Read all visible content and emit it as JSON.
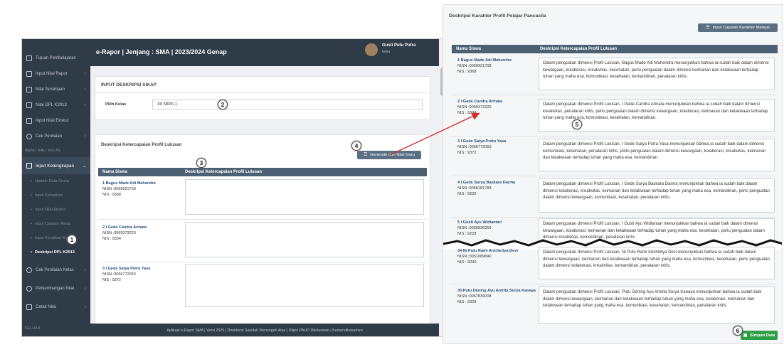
{
  "left": {
    "sidebar": {
      "items": [
        {
          "label": "Tujuan Pembelajaran",
          "icon": "book-icon",
          "chevron": ""
        },
        {
          "label": "Input Nilai Rapor",
          "icon": "table-icon",
          "chevron": "‹"
        },
        {
          "label": "Nilai Tersimpan",
          "icon": "table-icon",
          "chevron": "‹"
        },
        {
          "label": "Nilai DPL K2013",
          "icon": "table-icon",
          "chevron": "‹"
        },
        {
          "label": "Input Nilai Ekskul",
          "icon": "book-icon",
          "chevron": ""
        },
        {
          "label": "Cek Penilaian",
          "icon": "layers-icon",
          "chevron": "‹"
        }
      ],
      "section_header": "MENU WALI KELAS",
      "active_parent": {
        "label": "Input Kelengkapan",
        "chevron": "⌄"
      },
      "sub_items": [
        "Update Data Siswa",
        "Input Kehadiran",
        "Input Nilai Ekskul",
        "Input Catatan Walas",
        "Input Kenaikan Kelas",
        "Deskripsi DPL K2013"
      ],
      "items2": [
        {
          "label": "Cek Penilaian Kelas",
          "chevron": "‹"
        },
        {
          "label": "Perkembangan Nilai",
          "chevron": "‹"
        },
        {
          "label": "Cetak Nilai",
          "chevron": "‹"
        }
      ],
      "keluar": "KELUAR"
    },
    "topbar": {
      "title": "e-Rapor | Jenjang : SMA | 2023/2024 Genap",
      "user_name": "Gusti Putu Putra",
      "user_role": "Guru"
    },
    "card1": {
      "title": "INPUT DESKRIPSI SIKAP",
      "pilih_kelas_label": "Pilih Kelas",
      "pilih_kelas_value": "XII MIPA 1"
    },
    "card2": {
      "title": "Deskripsi Ketercapaian Profil Lulusan",
      "generate_button": "Generate dari Nilai Guru",
      "col_name": "Nama Siswa",
      "col_desc": "Deskripsi Ketercapaian Profil Lulusan",
      "rows": [
        {
          "name": "1 Bagus Made Adi Mahendra",
          "nisn": "NISN :0069921708",
          "nis": "NIS : 9368"
        },
        {
          "name": "2 I Gede Candra Arinata",
          "nisn": "NISN :0069373220",
          "nis": "NIS : 9334"
        },
        {
          "name": "3 I Gede Satya Putra Yasa",
          "nisn": "NISN :0066772053",
          "nis": "NIS : 9372"
        }
      ]
    },
    "footer": "Aplikasi e-Rapor SMA | Versi 2025 | Direktorat Sekolah Menengah Atas | Ditjen PAUD Dikdasmen | Kemendikdasmen"
  },
  "right": {
    "title": "Deskripsi Karakter Profil Pelajar Pancasila",
    "manual_button": "Input Capaian Karakter Manual",
    "col_name": "Nama Siswa",
    "col_desc": "Deskripsi Ketercapaian Profil Lulusan",
    "rows": [
      {
        "name": "1 Bagus Made Adi Mahendra",
        "nisn": "NISN :0069921708",
        "nis": "NIS : 9368",
        "desc": "Dalam penguatan dimensi Profil Lulusan, Bagus Made Adi Mahendra menunjukkan bahwa ia sudah baik dalam dimensi kewargaan, kolaborasi, kreativitas, kesehatan, perlu penguatan dalam dimensi keimanan dan ketakwaan terhadap tuhan yang maha esa, komunikasi, kesehatan, kemandirian, penalaran kritis."
      },
      {
        "name": "2 I Gede Candra Arinata",
        "nisn": "NISN :0069373220",
        "nis": "NIS : 9334",
        "desc": "Dalam penguatan dimensi Profil Lulusan, I Gede Candra Arinata menunjukkan bahwa ia sudah baik dalam dimensi kreativitas, penalaran kritis, perlu penguatan dalam dimensi kewargaan, kolaborasi, keimanan dan ketakwaan terhadap tuhan yang maha esa, komunikasi, kesehatan, kemandirian."
      },
      {
        "name": "3 I Gede Satya Putra Yasa",
        "nisn": "NISN :0066772053",
        "nis": "NIS : 9372",
        "desc": "Dalam penguatan dimensi Profil Lulusan, I Gede Satya Putra Yasa menunjukkan bahwa ia sudah baik dalam dimensi komunikasi, kesehatan, penalaran kritis, perlu penguatan dalam dimensi kewargaan, kolaborasi, kreativitas, keimanan dan ketakwaan terhadap tuhan yang maha esa, kemandirian."
      },
      {
        "name": "4 I Gede Surya Baskara Darma",
        "nisn": "NISN :0068181784",
        "nis": "NIS : 9226",
        "desc": "Dalam penguatan dimensi Profil Lulusan, I Gede Surya Baskara Darma menunjukkan bahwa ia sudah baik dalam dimensi kolaborasi, kreativitas, keimanan dan ketakwaan terhadap tuhan yang maha esa, kemandirian, perlu penguatan dalam dimensi kewargaan, komunikasi, kesehatan, penalaran kritis."
      },
      {
        "name": "5 I Gusti Ayu Widiantari",
        "nisn": "NISN :0066836259",
        "nis": "NIS : 9228",
        "desc": "Dalam penguatan dimensi Profil Lulusan, I Gusti Ayu Widiantari menunjukkan bahwa ia sudah baik dalam dimensi kewargaan, kolaborasi, keimanan dan ketakwaan terhadap tuhan yang maha esa, kesehatan, perlu penguatan dalam dimensi kreativitas, kemandirian, penalaran kritis"
      },
      {
        "name": "34 Ni Putu Rami Artchintya Devi",
        "nisn": "NISN :0051089840",
        "nis": "NIS : 9290",
        "desc": "Dalam penguatan dimensi Profil Lulusan, Ni Putu Rami Artchintya Devi menunjukkan bahwa ia sudah baik dalam dimensi kewargaan, keimanan dan ketakwaan terhadap tuhan yang maha esa, komunikasi, kesehatan, perlu penguatan dalam dimensi kolaborasi, kreativitas, kemandirian, penalaran kritis."
      },
      {
        "name": "35 Putu Dening Ayu Amrita Surya Kanaya",
        "nisn": "NISN :0067839008",
        "nis": "NIS : 9329",
        "desc": "Dalam penguatan dimensi Profil Lulusan, Putu Dening Ayu Amrita Surya Kanaya menunjukkan bahwa ia sudah baik dalam dimensi kewargaan, keimanan dan ketakwaan terhadap tuhan yang maha esa, kolaborasi, keimanan dan ketakwaan terhadap tuhan yang maha esa, komunikasi, kesehatan, kemandirian, penalaran kritis."
      }
    ],
    "save_button": "Simpan Data"
  },
  "badges": [
    "1",
    "2",
    "3",
    "4",
    "5",
    "6"
  ],
  "colors": {
    "sidebar": "#2f3b47",
    "table_header": "#4c6073",
    "save_green": "#2f9e45",
    "arrow_red": "#d32f2f"
  }
}
